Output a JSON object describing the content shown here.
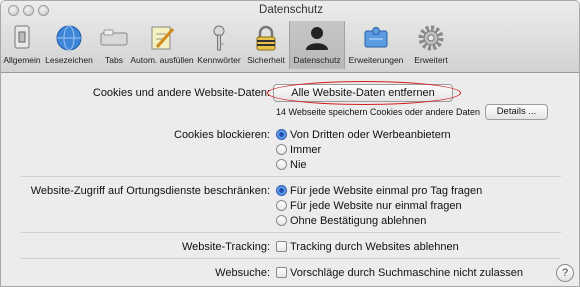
{
  "window": {
    "title": "Datenschutz"
  },
  "toolbar": {
    "items": [
      {
        "label": "Allgemein",
        "icon": "general-switch-icon"
      },
      {
        "label": "Lesezeichen",
        "icon": "globe-icon"
      },
      {
        "label": "Tabs",
        "icon": "tabs-icon"
      },
      {
        "label": "Autom. ausfüllen",
        "icon": "pencil-form-icon"
      },
      {
        "label": "Kennwörter",
        "icon": "key-icon"
      },
      {
        "label": "Sicherheit",
        "icon": "padlock-icon"
      },
      {
        "label": "Datenschutz",
        "icon": "person-silhouette-icon",
        "selected": true
      },
      {
        "label": "Erweiterungen",
        "icon": "puzzle-icon"
      },
      {
        "label": "Erweitert",
        "icon": "gear-icon"
      }
    ]
  },
  "cookies": {
    "label": "Cookies und andere Website-Daten:",
    "remove_all_button": "Alle Website-Daten entfernen",
    "summary": "14 Webseite speichern Cookies oder andere Daten",
    "details_button": "Details ..."
  },
  "block_cookies": {
    "label": "Cookies blockieren:",
    "options": [
      "Von Dritten oder Werbeanbietern",
      "Immer",
      "Nie"
    ],
    "selected": "Von Dritten oder Werbeanbietern"
  },
  "location": {
    "label": "Website-Zugriff auf Ortungsdienste beschränken:",
    "options": [
      "Für jede Website einmal pro Tag fragen",
      "Für jede Website nur einmal fragen",
      "Ohne Bestätigung ablehnen"
    ],
    "selected": "Für jede Website einmal pro Tag fragen"
  },
  "tracking": {
    "label": "Website-Tracking:",
    "checkbox_label": "Tracking durch Websites ablehnen",
    "checked": false
  },
  "websearch": {
    "label": "Websuche:",
    "checkbox_label": "Vorschläge durch Suchmaschine nicht zulassen",
    "checked": false
  },
  "help": {
    "symbol": "?"
  },
  "colors": {
    "accent": "#3c7fdb",
    "highlight": "#d31c1c"
  }
}
